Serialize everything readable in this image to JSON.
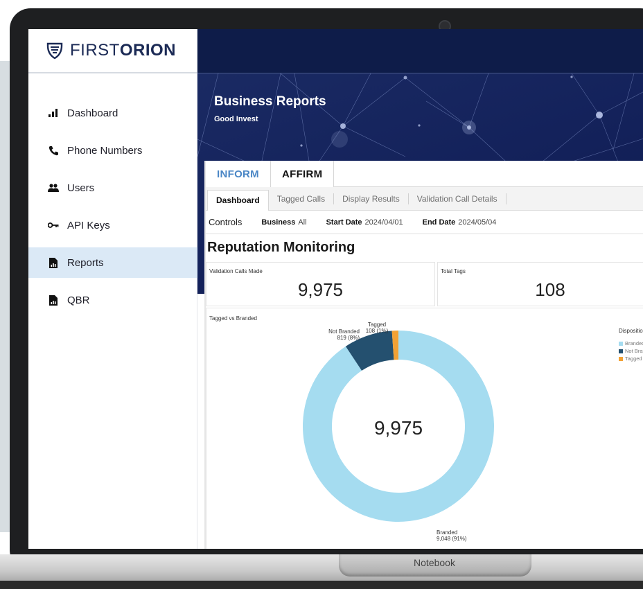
{
  "brand": {
    "logo_text_light": "FIRST",
    "logo_text_bold": "ORION"
  },
  "sidebar": {
    "items": [
      {
        "label": "Dashboard",
        "icon": "bar-chart-icon"
      },
      {
        "label": "Phone Numbers",
        "icon": "phone-icon"
      },
      {
        "label": "Users",
        "icon": "users-icon"
      },
      {
        "label": "API Keys",
        "icon": "key-icon"
      },
      {
        "label": "Reports",
        "icon": "report-icon",
        "active": true
      },
      {
        "label": "QBR",
        "icon": "report-icon"
      }
    ]
  },
  "header": {
    "title": "Business Reports",
    "subtitle": "Good Invest"
  },
  "tabs": {
    "primary": [
      "INFORM",
      "AFFIRM"
    ],
    "secondary": [
      "Dashboard",
      "Tagged Calls",
      "Display Results",
      "Validation Call Details"
    ]
  },
  "controls": {
    "title": "Controls",
    "business_label": "Business",
    "business_value": "All",
    "start_label": "Start Date",
    "start_value": "2024/04/01",
    "end_label": "End Date",
    "end_value": "2024/05/04"
  },
  "section": {
    "title": "Reputation Monitoring"
  },
  "kpis": [
    {
      "label": "Validation Calls Made",
      "value": "9,975"
    },
    {
      "label": "Total Tags",
      "value": "108"
    }
  ],
  "chart_data": {
    "type": "pie",
    "title": "Tagged vs Branded",
    "center_label": "9,975",
    "legend_title": "Disposition",
    "legend_position": "right",
    "slices": [
      {
        "name": "Branded",
        "value": 9048,
        "label": "9,048 (91%)",
        "color": "#a5dcf0"
      },
      {
        "name": "Not Branded",
        "value": 819,
        "label": "819 (8%)",
        "color": "#24506f"
      },
      {
        "name": "Tagged",
        "value": 108,
        "label": "108 (1%)",
        "color": "#f2a235"
      }
    ]
  },
  "device": {
    "label": "Notebook"
  },
  "colors": {
    "navy": "#0e1c49",
    "accent": "#4a86c5",
    "active_nav": "#dbe9f6"
  }
}
